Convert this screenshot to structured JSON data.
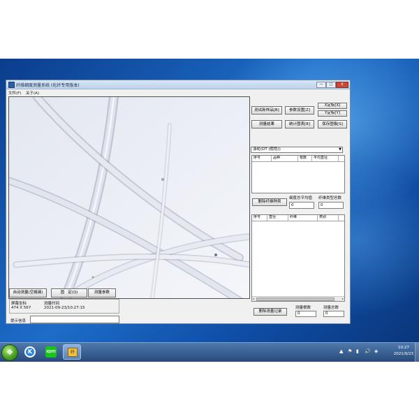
{
  "window": {
    "title": "纤维细度测量系统 (化纤专用版本)",
    "controls": {
      "minimize": "—",
      "maximize": "□",
      "close": "X"
    }
  },
  "menu": [
    "文件(F)",
    "关于(A)"
  ],
  "buttons": {
    "test_sample": "测试新样品[B]",
    "param_settings": "参数设置[Z]",
    "x_calibrate": "X定标[X]",
    "y_calibrate": "Y定标[Y]",
    "measure_result": "测量结果",
    "stats_chart": "统计图表[B]",
    "save_image": "保存图像[S]",
    "delete_fiber_type": "删除纤维种类",
    "delete_record": "删除测量记录",
    "auto_measure": "自动测量(空格键)",
    "freeze": "固   定(Q)",
    "measure_params": "测量参数"
  },
  "fiber_select": {
    "value": "涤纶(DT (假色))"
  },
  "summary_table": {
    "columns": [
      "序号",
      "品种",
      "根数",
      "平均直径"
    ]
  },
  "fiber_stats": {
    "avg_label": "细度总平均值",
    "avg_value": "0",
    "types_label": "纤维类型总数",
    "types_value": "0"
  },
  "detail_table": {
    "columns": [
      "序号",
      "直径",
      "纤维",
      "类别"
    ],
    "scroll_arrow_left": "◂",
    "scroll_arrow_right": "▸"
  },
  "record_stats": {
    "count_label": "测量根数",
    "count_value": "0",
    "total_label": "测量总数",
    "total_value": "0"
  },
  "coords": {
    "label": "屏幕坐标",
    "value": "474 X 567"
  },
  "measure_time": {
    "label": "测量时间",
    "value": "2021-09-23/10:27:15"
  },
  "hint": {
    "label": "提示信息",
    "value": ""
  },
  "taskbar": {
    "start_glyph": "❖",
    "k_glyph": "K",
    "iqiyi_glyph": "iQIYI",
    "app_glyph": "纤",
    "tray_icons": [
      "▲",
      "⚑",
      "▮",
      "🔊",
      "◈"
    ],
    "time": "10:27",
    "date": "2021/9/23"
  },
  "colors": {
    "fiber": "#c9ced9",
    "fiber_edge": "#8a93a6",
    "desktop_blue": "#1d6cc8",
    "taskbar": "#274a7a"
  }
}
